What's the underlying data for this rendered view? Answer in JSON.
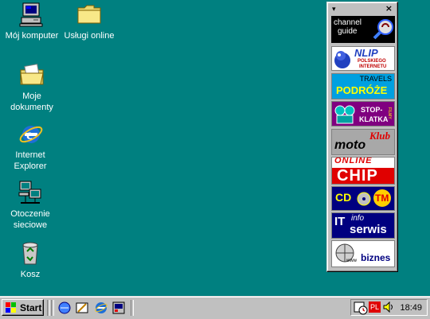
{
  "desktop": {
    "icons": [
      {
        "label": "Mój komputer"
      },
      {
        "label": "Usługi online"
      },
      {
        "label": "Moje dokumenty"
      },
      {
        "label": "Internet Explorer"
      },
      {
        "label": "Otoczenie sieciowe"
      },
      {
        "label": "Kosz"
      }
    ]
  },
  "channel_bar": {
    "close_glyph": "×",
    "dropdown_glyph": "▾",
    "items": [
      {
        "line1": "channel",
        "line2": "guide"
      },
      {
        "main": "NLIP",
        "sub1": "POLSKIEGO",
        "sub2": "INTERNETU"
      },
      {
        "top": "TRAVELS",
        "main": "PODRÓŻE"
      },
      {
        "line1": "STOP-",
        "line2": "KLATKA",
        "side": "FILMY"
      },
      {
        "main": "moto",
        "script": "Klub"
      },
      {
        "top": "ONLINE",
        "main": "CHIP"
      },
      {
        "left": "CD",
        "right": "TM"
      },
      {
        "i": "IT",
        "top": "info",
        "main": "serwis"
      },
      {
        "main": "biznes",
        "small": "www"
      }
    ]
  },
  "taskbar": {
    "start_label": "Start",
    "tray_lang": "PL",
    "clock": "18:49"
  }
}
